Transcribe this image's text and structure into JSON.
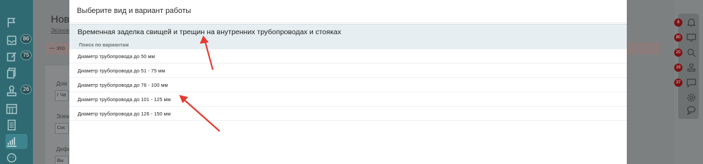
{
  "modal": {
    "title": "Выберите вид и вариант работы",
    "selected_work": "Временная заделка свищей и трещин на внутренних трубопроводах и стояках",
    "search_label": "Поиск по вариантам",
    "variants": [
      "Диаметр трубопровода до 50 мм",
      "Диаметр трубопровода до 51 - 75 мм",
      "Диаметр трубопровода до 76 - 100 мм",
      "Диаметр трубопровода до 101 - 125 мм",
      "Диаметр трубопровода до 126 - 150 мм"
    ]
  },
  "background": {
    "page_title": "Нова",
    "page_subtitle": "Эконом",
    "alert_text": "— это",
    "fields": [
      {
        "label": "Дом",
        "value": "г Ча"
      },
      {
        "label": "Элем",
        "value": "Сис"
      },
      {
        "label": "Дефе",
        "value": "Вы"
      }
    ]
  },
  "left_sidebar": {
    "items": [
      {
        "icon": "flag-icon",
        "badge": ""
      },
      {
        "icon": "inbox-icon",
        "badge": "86"
      },
      {
        "icon": "edit-icon",
        "badge": "75"
      },
      {
        "icon": "copy-icon",
        "badge": ""
      },
      {
        "icon": "stamp-icon",
        "badge": "26"
      },
      {
        "icon": "calendar-icon",
        "badge": ""
      },
      {
        "icon": "document-icon",
        "badge": ""
      },
      {
        "icon": "chart-icon",
        "badge": ""
      },
      {
        "icon": "face-icon",
        "badge": ""
      }
    ]
  },
  "right_sidebar": {
    "items": [
      {
        "icon": "bell-icon",
        "badge": "8"
      },
      {
        "icon": "desktop-icon",
        "badge": "80"
      },
      {
        "icon": "search-user-icon",
        "badge": "20"
      },
      {
        "icon": "stamp-icon",
        "badge": "18"
      },
      {
        "icon": "message-icon",
        "badge": "37"
      },
      {
        "icon": "gear-icon",
        "badge": ""
      },
      {
        "icon": "chat-icon",
        "badge": ""
      }
    ]
  },
  "colors": {
    "overlay_bg": "#7f8384",
    "sidebar_teal": "#2f6a72",
    "selected_row": "#e6eef1",
    "badge_red": "#7a1315",
    "arrow_red": "#e53a30"
  }
}
